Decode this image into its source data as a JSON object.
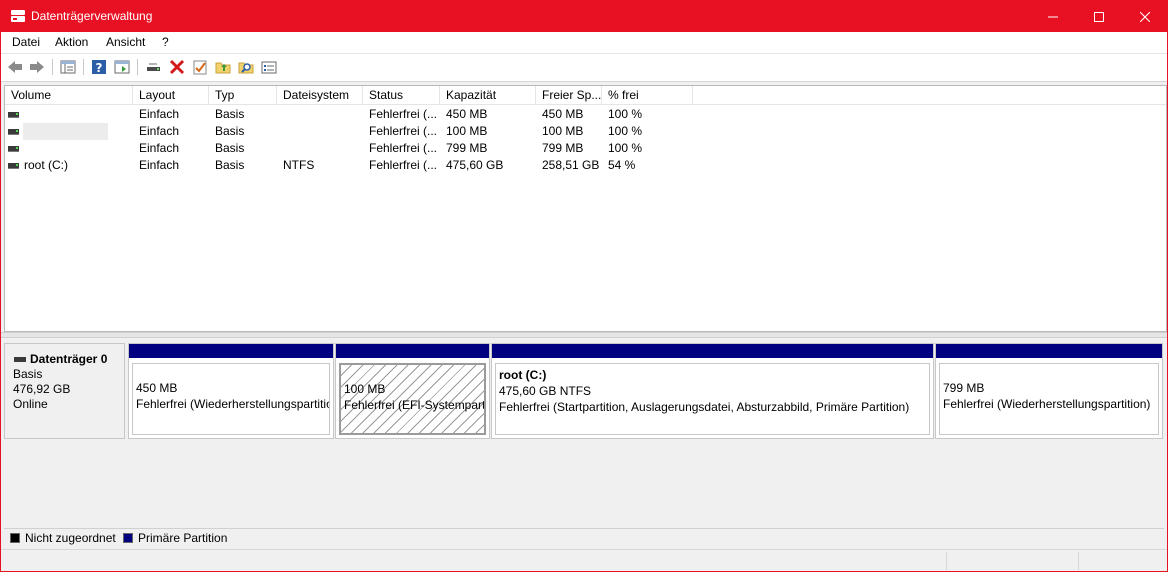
{
  "window": {
    "title": "Datenträgerverwaltung"
  },
  "menu": {
    "items": [
      "Datei",
      "Aktion",
      "Ansicht",
      "?"
    ]
  },
  "toolbar": {
    "buttons": [
      "back-icon",
      "forward-icon",
      "console-tree-icon",
      "help-icon",
      "properties-view-icon",
      "connect-drive-icon",
      "delete-icon",
      "check-icon",
      "folder-up-icon",
      "search-icon",
      "properties-icon"
    ]
  },
  "columns": {
    "volume": "Volume",
    "layout": "Layout",
    "type": "Typ",
    "filesystem": "Dateisystem",
    "status": "Status",
    "capacity": "Kapazität",
    "free": "Freier Sp...",
    "pct": "% frei"
  },
  "rows": [
    {
      "volume": "",
      "layout": "Einfach",
      "type": "Basis",
      "filesystem": "",
      "status": "Fehlerfrei (...",
      "capacity": "450 MB",
      "free": "450 MB",
      "pct": "100 %"
    },
    {
      "volume": "",
      "layout": "Einfach",
      "type": "Basis",
      "filesystem": "",
      "status": "Fehlerfrei (...",
      "capacity": "100 MB",
      "free": "100 MB",
      "pct": "100 %"
    },
    {
      "volume": "",
      "layout": "Einfach",
      "type": "Basis",
      "filesystem": "",
      "status": "Fehlerfrei (...",
      "capacity": "799 MB",
      "free": "799 MB",
      "pct": "100 %"
    },
    {
      "volume": "root (C:)",
      "layout": "Einfach",
      "type": "Basis",
      "filesystem": "NTFS",
      "status": "Fehlerfrei (...",
      "capacity": "475,60 GB",
      "free": "258,51 GB",
      "pct": "54 %"
    }
  ],
  "disk": {
    "name": "Datenträger 0",
    "type": "Basis",
    "size": "476,92 GB",
    "state": "Online",
    "bar_color": "#000080",
    "partitions": [
      {
        "title": "",
        "size": "450 MB",
        "status": "Fehlerfrei (Wiederherstellungspartition)"
      },
      {
        "title": "",
        "size": "100 MB",
        "status": "Fehlerfrei (EFI-Systempartition)"
      },
      {
        "title": "root  (C:)",
        "size": "475,60 GB NTFS",
        "status": "Fehlerfrei (Startpartition, Auslagerungsdatei, Absturzabbild, Primäre Partition)"
      },
      {
        "title": "",
        "size": "799 MB",
        "status": "Fehlerfrei (Wiederherstellungspartition)"
      }
    ]
  },
  "legend": {
    "unallocated": "Nicht zugeordnet",
    "unallocated_color": "#000000",
    "primary": "Primäre Partition",
    "primary_color": "#000080"
  },
  "colors": {
    "titlebar": "#e81123",
    "accent": "#000080"
  }
}
